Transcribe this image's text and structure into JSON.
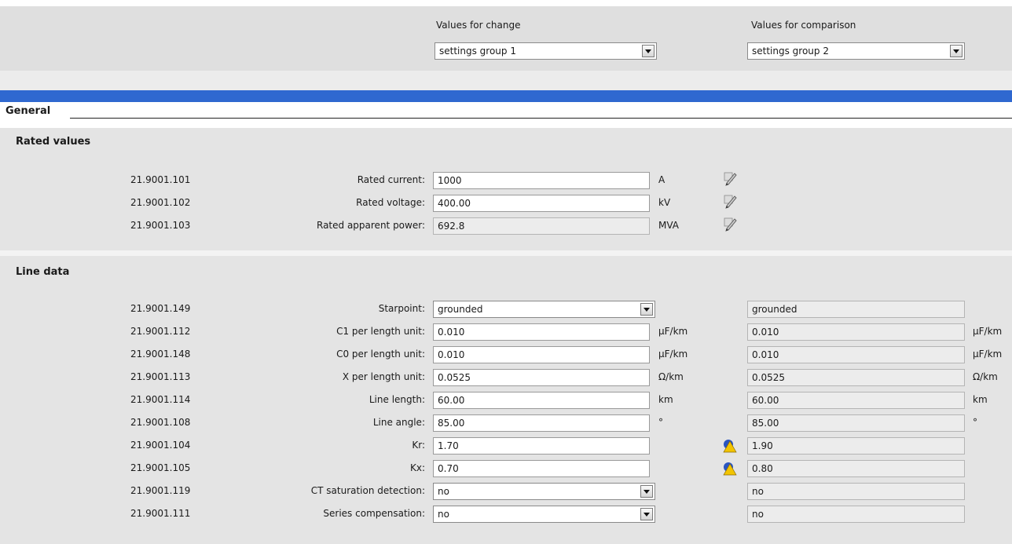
{
  "header": {
    "change_label": "Values for change",
    "change_value": "settings group 1",
    "compare_label": "Values for comparison",
    "compare_value": "settings group 2"
  },
  "general_title": "General",
  "rated": {
    "title": "Rated values",
    "rows": [
      {
        "id": "21.9001.101",
        "label": "Rated current:",
        "value": "1000",
        "unit": "A"
      },
      {
        "id": "21.9001.102",
        "label": "Rated voltage:",
        "value": "400.00",
        "unit": "kV"
      },
      {
        "id": "21.9001.103",
        "label": "Rated apparent power:",
        "value": "692.8",
        "unit": "MVA"
      }
    ]
  },
  "line": {
    "title": "Line data",
    "rows": [
      {
        "id": "21.9001.149",
        "label": "Starpoint:",
        "value": "grounded",
        "unit": "",
        "cmp": "grounded",
        "cmp_unit": ""
      },
      {
        "id": "21.9001.112",
        "label": "C1 per length unit:",
        "value": "0.010",
        "unit": "µF/km",
        "cmp": "0.010",
        "cmp_unit": "µF/km"
      },
      {
        "id": "21.9001.148",
        "label": "C0 per length unit:",
        "value": "0.010",
        "unit": "µF/km",
        "cmp": "0.010",
        "cmp_unit": "µF/km"
      },
      {
        "id": "21.9001.113",
        "label": "X per length unit:",
        "value": "0.0525",
        "unit": "Ω/km",
        "cmp": "0.0525",
        "cmp_unit": "Ω/km"
      },
      {
        "id": "21.9001.114",
        "label": "Line length:",
        "value": "60.00",
        "unit": "km",
        "cmp": "60.00",
        "cmp_unit": "km"
      },
      {
        "id": "21.9001.108",
        "label": "Line angle:",
        "value": "85.00",
        "unit": "°",
        "cmp": "85.00",
        "cmp_unit": "°"
      },
      {
        "id": "21.9001.104",
        "label": "Kr:",
        "value": "1.70",
        "unit": "",
        "cmp": "1.90",
        "cmp_unit": ""
      },
      {
        "id": "21.9001.105",
        "label": "Kx:",
        "value": "0.70",
        "unit": "",
        "cmp": "0.80",
        "cmp_unit": ""
      },
      {
        "id": "21.9001.119",
        "label": "CT saturation detection:",
        "value": "no",
        "unit": "",
        "cmp": "no",
        "cmp_unit": ""
      },
      {
        "id": "21.9001.111",
        "label": "Series compensation:",
        "value": "no",
        "unit": "",
        "cmp": "no",
        "cmp_unit": ""
      }
    ]
  },
  "icons": {
    "pencil": "edit-pencil-icon",
    "difference": "difference-warning-icon"
  },
  "colors": {
    "accent_bar": "#2f68d0",
    "panel_bg": "#e4e4e4"
  }
}
